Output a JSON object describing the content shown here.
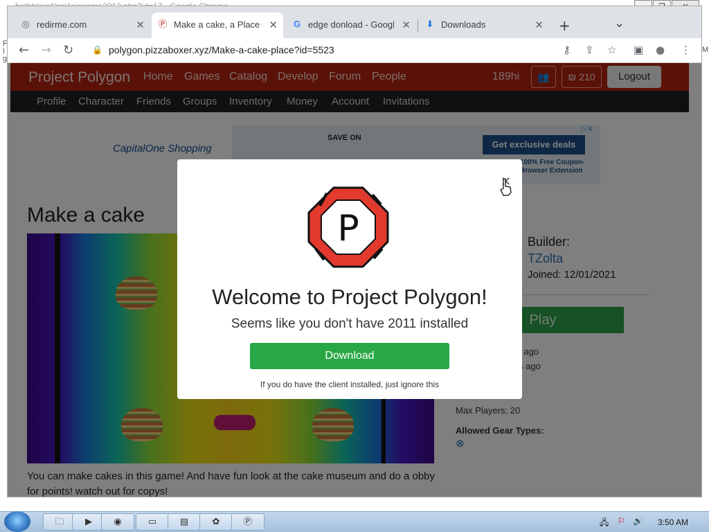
{
  "background": {
    "window_title": "bethbloxsf/api/joingame2012.php?id=17 - Google Chrome",
    "left_fragment": "F I g",
    "right_fragment": "M"
  },
  "window_controls": {
    "minimize": "—",
    "restore": "❐",
    "close": "✕"
  },
  "tabs": [
    {
      "label": "redirme.com",
      "icon": "globe-icon",
      "glyph": "◎",
      "close": "✕"
    },
    {
      "label": "Make a cake, a Place by",
      "icon": "polygon-icon",
      "glyph": "Ⓟ",
      "close": "✕"
    },
    {
      "label": "edge donload - Google",
      "icon": "google-icon",
      "glyph": "G",
      "close": "✕"
    },
    {
      "label": "Downloads",
      "icon": "download-icon",
      "glyph": "⬇",
      "close": "✕"
    }
  ],
  "new_tab": "+",
  "tab_menu": "⌄",
  "nav": {
    "back": "←",
    "forward": "→",
    "reload": "↻",
    "lock": "🔒"
  },
  "url": "polygon.pizzaboxer.xyz/Make-a-cake-place?id=5523",
  "toolbar_icons": {
    "key": "⚷",
    "share": "⇪",
    "star": "☆",
    "sidepanel": "▣",
    "profile": "●",
    "menu": "⋮"
  },
  "site": {
    "brand": "Project Polygon",
    "nav": [
      "Home",
      "Games",
      "Catalog",
      "Develop",
      "Forum",
      "People"
    ],
    "user": "189hi",
    "friends_glyph": "👥",
    "currency": "210",
    "currency_glyph": "₪",
    "logout": "Logout",
    "subnav": [
      "Profile",
      "Character",
      "Friends",
      "Groups",
      "Inventory",
      "Money",
      "Account",
      "Invitations"
    ]
  },
  "ad": {
    "brand": "CapitalOne",
    "shopping": "Shopping",
    "save_on": "SAVE ON",
    "deal_button": "Get exclusive deals",
    "coupon": "100% Free Coupon-Browser Extension",
    "adchoice": "▷✕"
  },
  "place": {
    "title": "Make a cake",
    "builder_label": "Builder:",
    "builder": "TZolta",
    "joined": "Joined: 12/01/2021",
    "play": "Play",
    "time1": "ns ago",
    "time2": "s ago",
    "max_players": "Max Players: 20",
    "gear_label": "Allowed Gear Types:",
    "gear_icon": "⊗",
    "description": "You can make cakes in this game! And have fun look at the cake museum and do a obby for points! watch out for copys!"
  },
  "modal": {
    "close": "✕",
    "title": "Welcome to Project Polygon!",
    "subtitle": "Seems like you don't have 2011 installed",
    "download": "Download",
    "note": "If you do have the client installed, just ignore this",
    "logo_letter": "P"
  },
  "taskbar": {
    "apps": [
      {
        "name": "explorer",
        "glyph": "🗀"
      },
      {
        "name": "media-player",
        "glyph": "▶"
      },
      {
        "name": "chrome",
        "glyph": "◉"
      },
      {
        "name": "cmd",
        "glyph": "▭"
      },
      {
        "name": "notepad",
        "glyph": "▤"
      },
      {
        "name": "paint",
        "glyph": "✿"
      },
      {
        "name": "polygon",
        "glyph": "Ⓟ"
      }
    ],
    "tray": [
      "🖧",
      "⚐",
      "🔊"
    ],
    "clock": "3:50 AM"
  },
  "colors": {
    "site_red": "#b42411",
    "play_green": "#2ea34a",
    "download_green": "#28a745",
    "subnav_dark": "#1e2024"
  }
}
